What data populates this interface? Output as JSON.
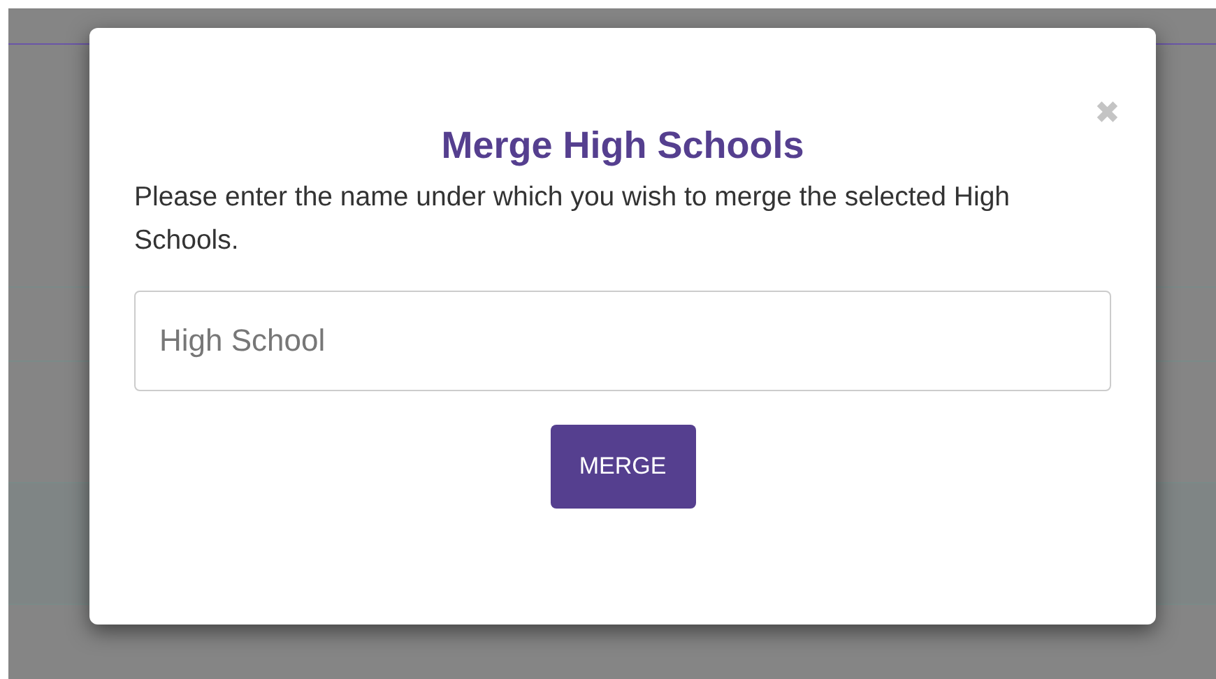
{
  "dialog": {
    "close": "✖",
    "title": "Merge High Schools",
    "message": "Please enter the name under which you wish to merge the selected High Schools.",
    "field": {
      "placeholder": "High School"
    },
    "button": "MERGE"
  }
}
